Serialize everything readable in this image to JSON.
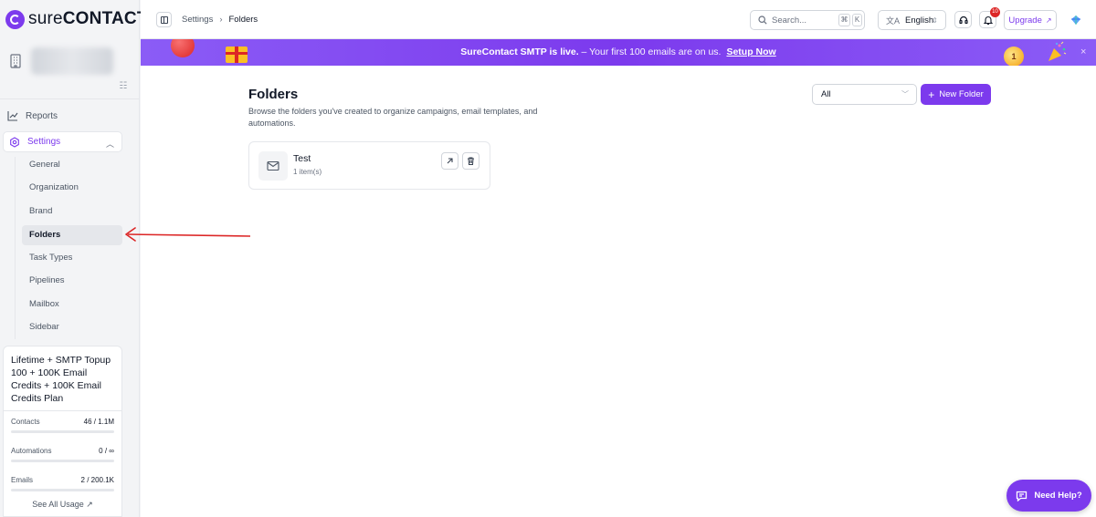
{
  "brand": {
    "name_light": "sure",
    "name_bold": "CONTACT"
  },
  "sidebar": {
    "reports_label": "Reports",
    "settings_label": "Settings",
    "sub_items": [
      "General",
      "Organization",
      "Brand",
      "Folders",
      "Task Types",
      "Pipelines",
      "Mailbox",
      "Sidebar"
    ],
    "active_item": "Folders"
  },
  "plan": {
    "title": "Lifetime + SMTP Topup 100 + 100K Email Credits + 100K Email Credits Plan",
    "usage": [
      {
        "label": "Contacts",
        "value": "46 / 1.1M",
        "fraction": 4e-05
      },
      {
        "label": "Automations",
        "value": "0 / ∞",
        "fraction": 0
      },
      {
        "label": "Emails",
        "value": "2 / 200.1K",
        "fraction": 1e-05
      }
    ],
    "see_all_label": "See All Usage"
  },
  "topbar": {
    "breadcrumb_parent": "Settings",
    "breadcrumb_current": "Folders",
    "search_placeholder": "Search...",
    "shortcut_cmd": "⌘",
    "shortcut_key": "K",
    "language": "English",
    "notification_count": "10",
    "upgrade_label": "Upgrade"
  },
  "banner": {
    "headline": "SureContact SMTP is live.",
    "text": " – Your first 100 emails are on us.",
    "cta": "Setup Now",
    "medal_number": "1"
  },
  "page": {
    "title": "Folders",
    "description": "Browse the folders you've created to organize campaigns, email templates, and automations.",
    "filter_value": "All",
    "new_folder_label": "New Folder"
  },
  "folders": [
    {
      "name": "Test",
      "count": "1 item(s)"
    }
  ],
  "help": {
    "label": "Need Help?"
  },
  "colors": {
    "accent": "#7c3aed",
    "annotation_arrow": "#dc2626",
    "badge": "#dc2626"
  }
}
